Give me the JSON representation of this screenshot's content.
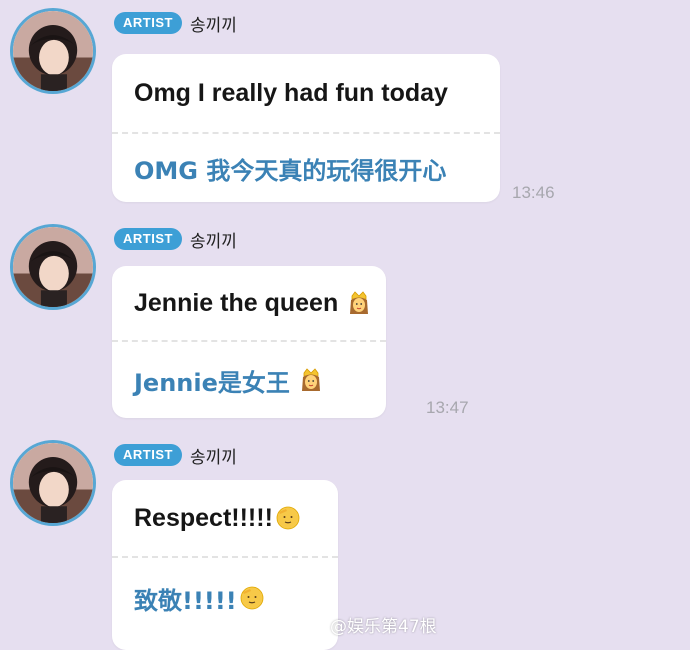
{
  "messages": [
    {
      "badge": "ARTIST",
      "sender": "송끼끼",
      "text_en": "Omg I really had fun today",
      "text_cn": "OMG 我今天真的玩得很开心",
      "time": "13:46"
    },
    {
      "badge": "ARTIST",
      "sender": "송끼끼",
      "text_en": "Jennie the queen",
      "text_cn": "Jennie是女王",
      "time": "13:47",
      "emoji": "crowned-woman-emoji"
    },
    {
      "badge": "ARTIST",
      "sender": "송끼끼",
      "text_en": "Respect!!!!!",
      "text_cn": "致敬!!!!!",
      "emoji": "saluting-face-emoji"
    }
  ],
  "watermark": {
    "icon": "weibo-logo-icon",
    "text": "@娱乐第47根"
  },
  "colors": {
    "background": "#e6dff0",
    "badge": "#3d9fd6",
    "translation_text": "#3b82b5",
    "timestamp": "#a7a7ae"
  }
}
